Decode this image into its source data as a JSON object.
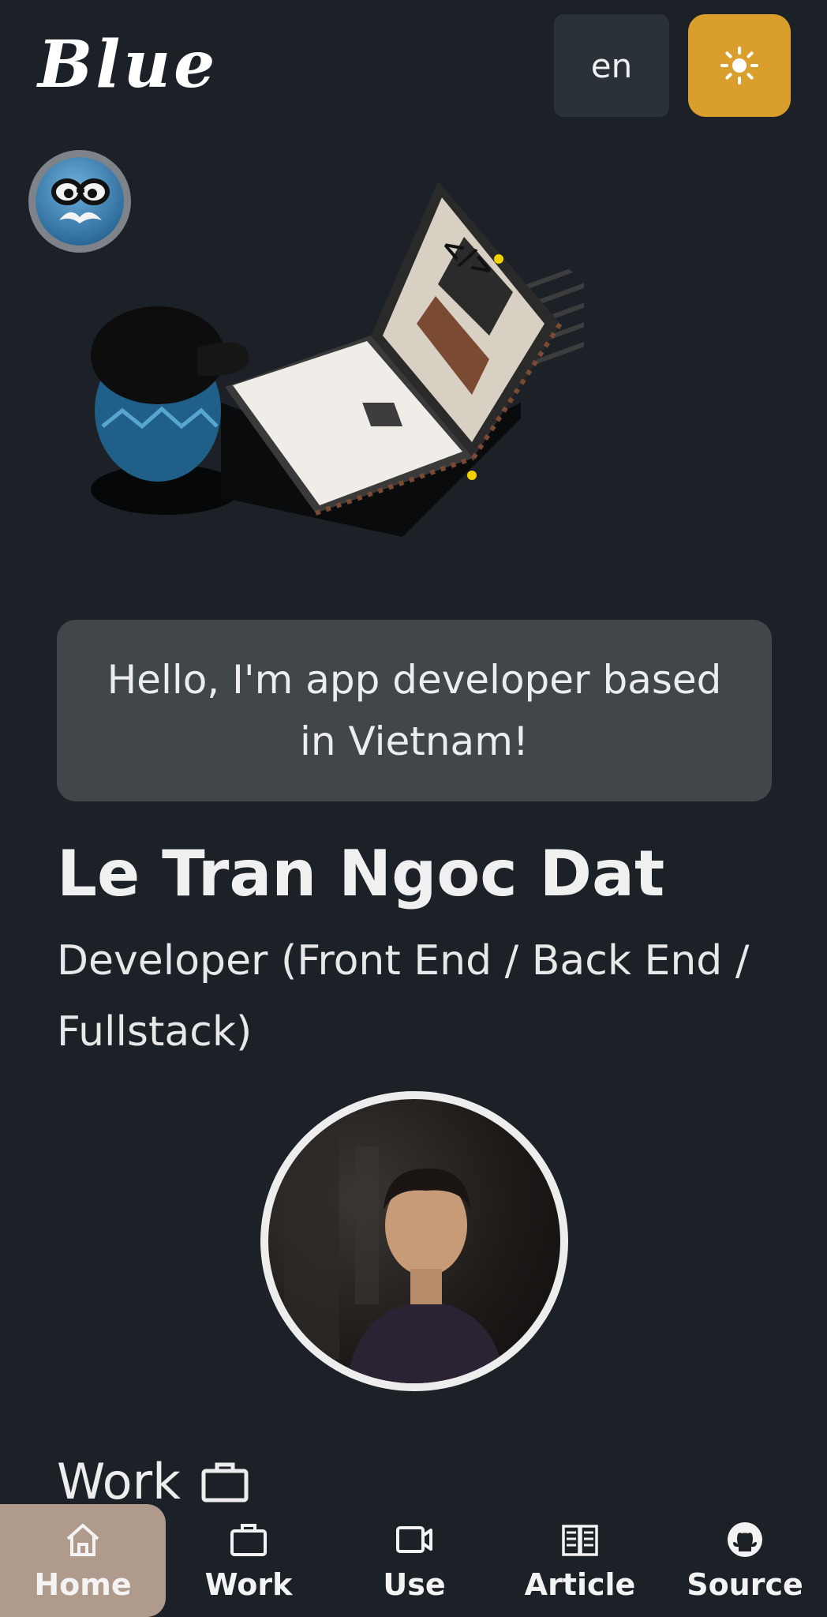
{
  "header": {
    "logo": "Blue",
    "language_label": "en",
    "theme_icon": "sun-icon"
  },
  "hero": {
    "greeting": "Hello, I'm app developer based in Vietnam!",
    "name": "Le Tran Ngoc Dat",
    "role": "Developer (Front End / Back End / Fullstack)"
  },
  "sections": {
    "work_title": "Work",
    "work_icon": "briefcase-icon"
  },
  "bottom_nav": {
    "items": [
      {
        "label": "Home",
        "icon": "home-icon",
        "active": true
      },
      {
        "label": "Work",
        "icon": "briefcase-icon",
        "active": false
      },
      {
        "label": "Use",
        "icon": "video-icon",
        "active": false
      },
      {
        "label": "Article",
        "icon": "newspaper-icon",
        "active": false
      },
      {
        "label": "Source",
        "icon": "github-icon",
        "active": false
      }
    ]
  },
  "colors": {
    "background": "#1b2126",
    "accent": "#d99e2b",
    "active_nav": "#b09a8b",
    "card": "#40464a"
  }
}
